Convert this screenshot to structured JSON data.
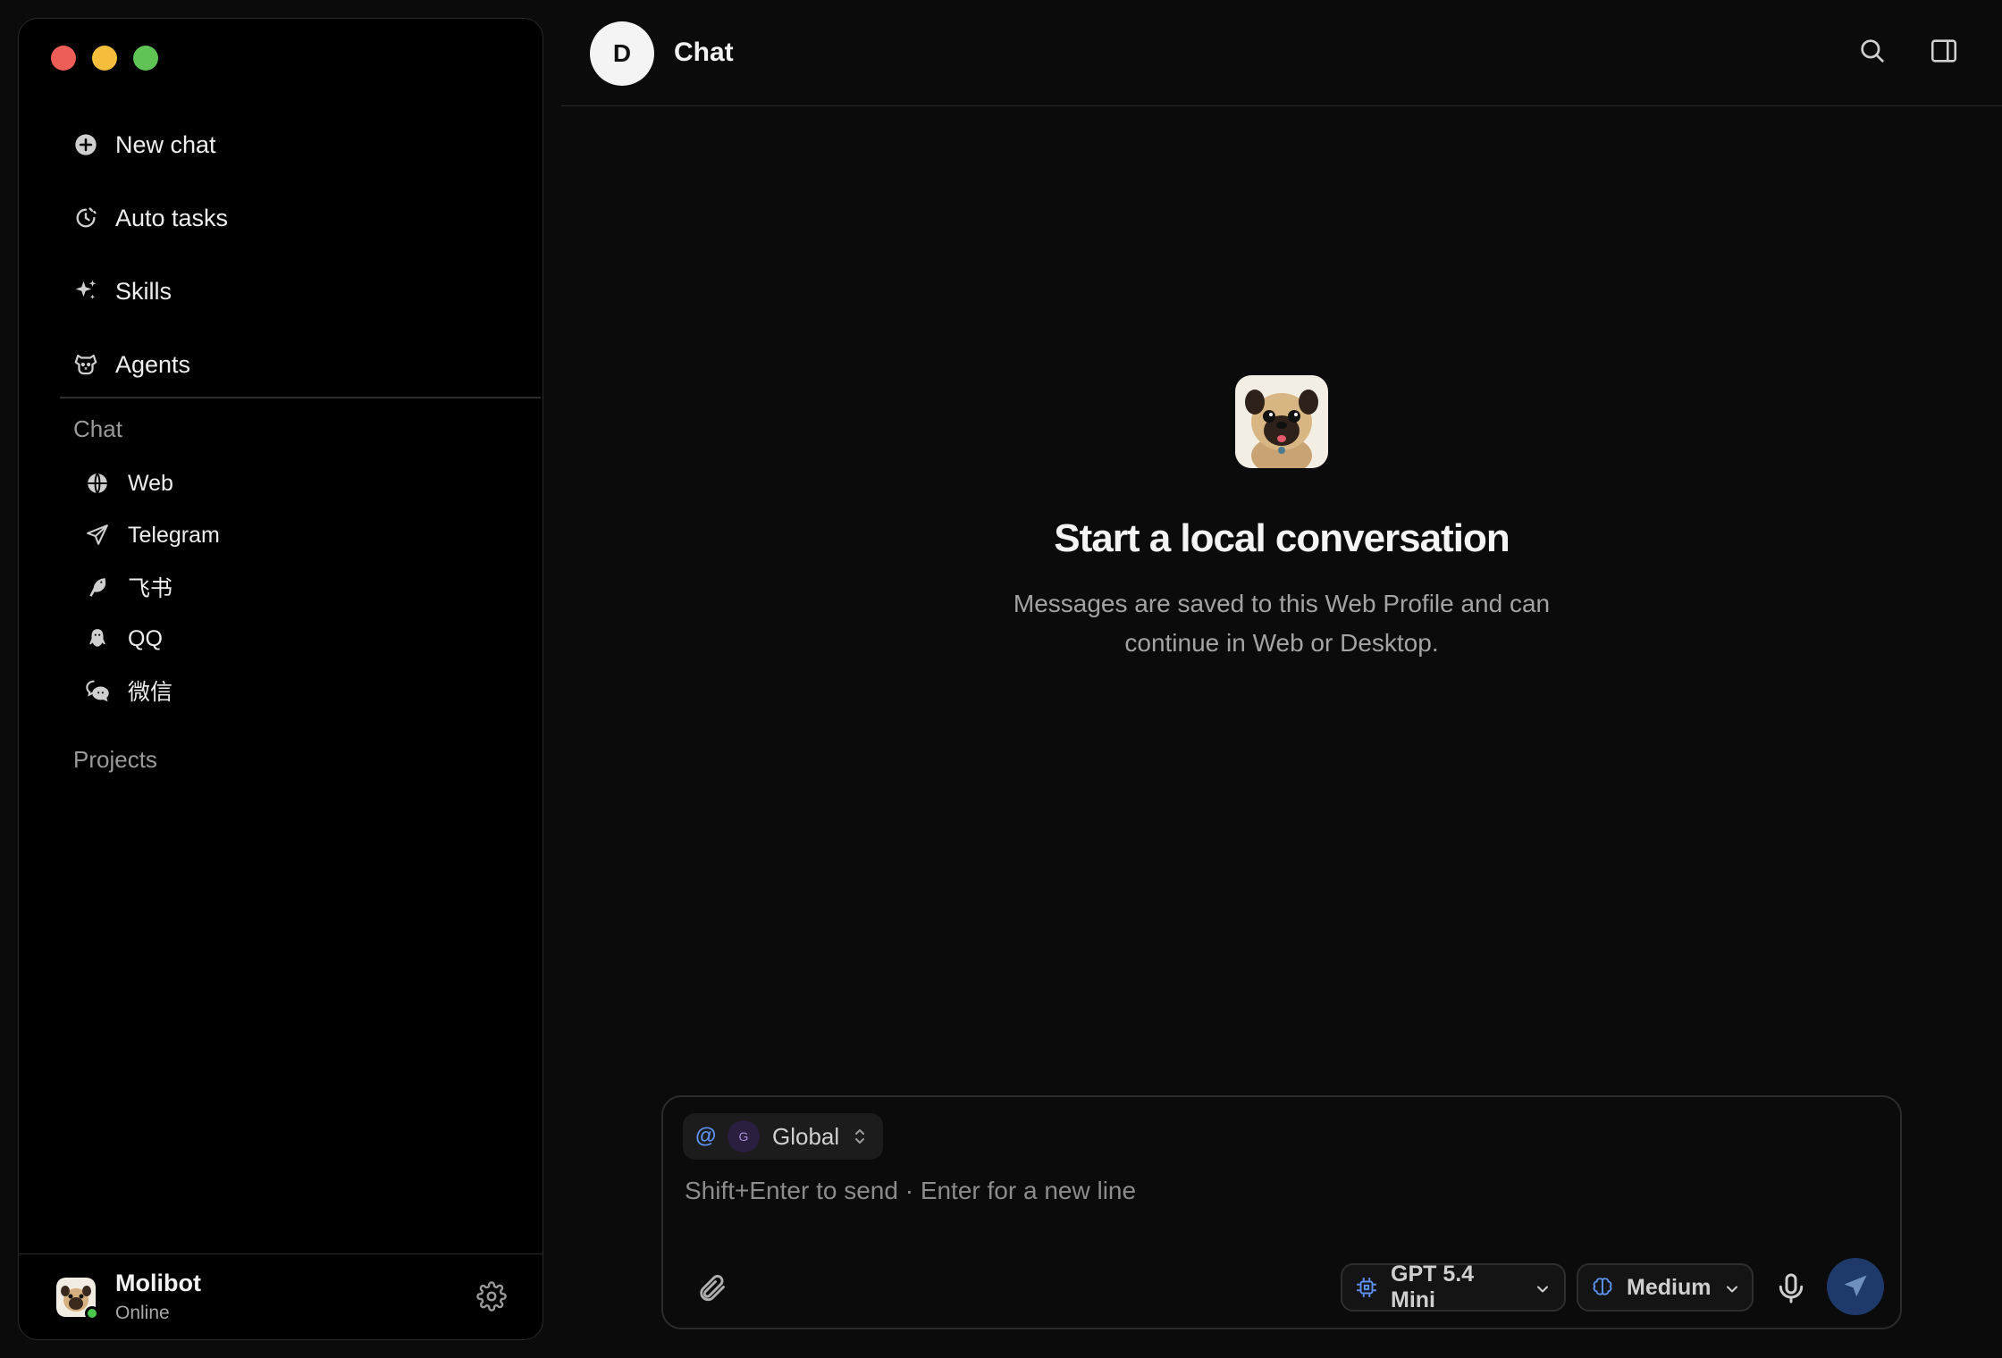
{
  "window": {
    "controls": [
      "close",
      "minimize",
      "zoom"
    ]
  },
  "sidebar": {
    "nav": [
      {
        "label": "New chat",
        "icon": "plus-circle-icon"
      },
      {
        "label": "Auto tasks",
        "icon": "clock-icon"
      },
      {
        "label": "Skills",
        "icon": "sparkle-icon"
      },
      {
        "label": "Agents",
        "icon": "dog-icon"
      }
    ],
    "chat_section_label": "Chat",
    "channels": [
      {
        "label": "Web",
        "icon": "globe-icon"
      },
      {
        "label": "Telegram",
        "icon": "paper-plane-icon"
      },
      {
        "label": "飞书",
        "icon": "bird-icon"
      },
      {
        "label": "QQ",
        "icon": "penguin-icon"
      },
      {
        "label": "微信",
        "icon": "wechat-icon"
      }
    ],
    "projects_section_label": "Projects",
    "profile": {
      "name": "Molibot",
      "status": "Online",
      "status_color": "#4cc74e"
    }
  },
  "header": {
    "avatar_letter": "D",
    "title": "Chat"
  },
  "empty_state": {
    "title": "Start a local conversation",
    "description": "Messages are saved to this Web Profile and can continue in Web or Desktop."
  },
  "composer": {
    "mention_symbol": "@",
    "scope_avatar_letter": "G",
    "scope_label": "Global",
    "placeholder": "Shift+Enter to send · Enter for a new line",
    "model_label": "GPT 5.4 Mini",
    "effort_label": "Medium"
  },
  "colors": {
    "accent": "#5d92f0",
    "send_button": "#1d3a6a",
    "background": "#0b0b0b",
    "sidebar": "#000000"
  }
}
